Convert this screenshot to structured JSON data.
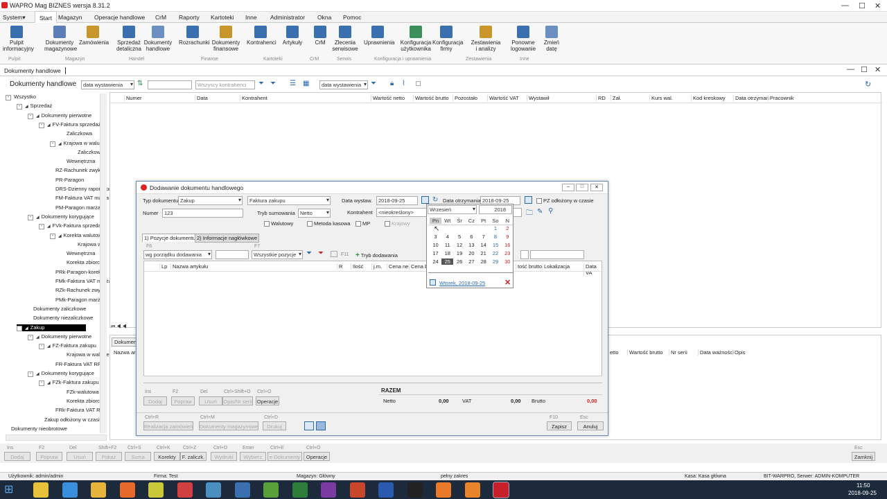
{
  "app": {
    "title": "WAPRO Mag BIZNES  wersja 8.31.2"
  },
  "menu": [
    "System",
    "Start",
    "Magazyn",
    "Operacje handlowe",
    "CrM",
    "Raporty",
    "Kartoteki",
    "Inne",
    "Administrator",
    "Okna",
    "Pomoc"
  ],
  "ribbon": {
    "buttons": [
      {
        "label": "Pulpit informacyjny",
        "color": "#3a6fb0"
      },
      {
        "label": "Dokumenty magazynowe",
        "color": "#5a7fb8"
      },
      {
        "label": "Zamówienia",
        "color": "#c8962b"
      },
      {
        "label": "Sprzedaż detaliczna",
        "color": "#3a6fb0"
      },
      {
        "label": "Dokumenty handlowe",
        "color": "#6a8fc0"
      },
      {
        "label": "Rozrachunki",
        "color": "#3a6fb0"
      },
      {
        "label": "Dokumenty finansowe",
        "color": "#c8962b"
      },
      {
        "label": "Kontrahenci",
        "color": "#3a6fb0"
      },
      {
        "label": "Artykuły",
        "color": "#3a6fb0"
      },
      {
        "label": "CrM",
        "color": "#3a6fb0"
      },
      {
        "label": "Zlecenia serwisowe",
        "color": "#3a6fb0"
      },
      {
        "label": "Uprawnienia",
        "color": "#3a6fb0"
      },
      {
        "label": "Konfiguracja użytkownika",
        "color": "#3a8f5a"
      },
      {
        "label": "Konfiguracja firmy",
        "color": "#3a6fb0"
      },
      {
        "label": "Zestawienia i analizy",
        "color": "#c8962b"
      },
      {
        "label": "Ponowne logowanie",
        "color": "#3a6fb0"
      },
      {
        "label": "Zmień datę",
        "color": "#6a8fc0"
      }
    ],
    "groups": [
      "Pulpit",
      "Magazyn",
      "Handel",
      "Finanse",
      "Kartoteki",
      "CrM",
      "Serwis",
      "Konfiguracja i uprawnienia",
      "Zestawienia",
      "Inne"
    ]
  },
  "doc_tab": "Dokumenty handlowe",
  "toolbar": {
    "title": "Dokumenty handlowe",
    "sort": "data wystawienia",
    "contractor": "Wszyscy kontrahenci",
    "sort2": "data wystawienia"
  },
  "tree": [
    {
      "label": "Wszystko",
      "level": 0,
      "box": "-"
    },
    {
      "label": "Sprzedaż",
      "level": 1,
      "box": "-"
    },
    {
      "label": "Dokumenty pierwotne",
      "level": 2,
      "box": "-"
    },
    {
      "label": "FV-Faktura sprzedaży",
      "level": 3,
      "box": "-"
    },
    {
      "label": "Zaliczkowa",
      "level": 5,
      "box": ""
    },
    {
      "label": "Krajowa w walucie",
      "level": 4,
      "box": "-"
    },
    {
      "label": "Zaliczkowa",
      "level": 6,
      "box": ""
    },
    {
      "label": "Wewnętrzna",
      "level": 5,
      "box": ""
    },
    {
      "label": "RZ-Rachunek zwykły",
      "level": 4,
      "box": ""
    },
    {
      "label": "PR-Paragon",
      "level": 4,
      "box": ""
    },
    {
      "label": "DRS-Dzienny raport sprzedaży",
      "level": 4,
      "box": ""
    },
    {
      "label": "FM-Faktura VAT marża",
      "level": 4,
      "box": ""
    },
    {
      "label": "PM-Paragon marża",
      "level": 4,
      "box": ""
    },
    {
      "label": "Dokumenty korygujące",
      "level": 2,
      "box": "-"
    },
    {
      "label": "FVk-Faktura sprzedaży",
      "level": 3,
      "box": "-"
    },
    {
      "label": "Korekta walutowa",
      "level": 4,
      "box": "-"
    },
    {
      "label": "Krajowa w",
      "level": 6,
      "box": ""
    },
    {
      "label": "Wewnętrzna",
      "level": 5,
      "box": ""
    },
    {
      "label": "Korekta zbiorcza",
      "level": 5,
      "box": ""
    },
    {
      "label": "PRk-Paragon-korekta",
      "level": 4,
      "box": ""
    },
    {
      "label": "FMk-Faktura VAT marża",
      "level": 4,
      "box": ""
    },
    {
      "label": "RZk-Rachunek zwykły",
      "level": 4,
      "box": ""
    },
    {
      "label": "PMk-Paragon marża",
      "level": 4,
      "box": ""
    },
    {
      "label": "Dokumenty zaliczkowe",
      "level": 2,
      "box": ""
    },
    {
      "label": "Dokumenty niezaliczkowe",
      "level": 2,
      "box": ""
    },
    {
      "label": "Zakup",
      "level": 1,
      "box": "-",
      "selected": true
    },
    {
      "label": "Dokumenty pierwotne",
      "level": 2,
      "box": "-"
    },
    {
      "label": "FZ-Faktura zakupu",
      "level": 3,
      "box": "-"
    },
    {
      "label": "Krajowa w walucie",
      "level": 5,
      "box": ""
    },
    {
      "label": "FR-Faktura VAT RR",
      "level": 4,
      "box": ""
    },
    {
      "label": "Dokumenty korygujące",
      "level": 2,
      "box": "-"
    },
    {
      "label": "FZk-Faktura zakupu",
      "level": 3,
      "box": "-"
    },
    {
      "label": "FZk-walutowa k",
      "level": 5,
      "box": ""
    },
    {
      "label": "Korekta zbiorcza",
      "level": 5,
      "box": ""
    },
    {
      "label": "FRk-Faktura VAT RR",
      "level": 4,
      "box": ""
    },
    {
      "label": "Zakup odłożony w czasie",
      "level": 3,
      "box": ""
    },
    {
      "label": "Dokumenty nieobrotowe",
      "level": 0,
      "box": ""
    }
  ],
  "grid": {
    "columns": [
      "Numer",
      "Data",
      "Kontrahent",
      "Wartość netto",
      "Wartość brutto",
      "Pozostało",
      "Wartość VAT",
      "Wystawił",
      "RD",
      "Zał.",
      "Kurs wal.",
      "Kod kreskowy",
      "Data otrzyman",
      "Pracownik"
    ]
  },
  "lower_grid": {
    "tab": "Dokument",
    "col0": "Nazwa ar",
    "columns": [
      "etto",
      "Wartość brutto",
      "Nr serii",
      "Data ważności",
      "Opis"
    ]
  },
  "dialog": {
    "title": "Dodawanie dokumentu handlowego",
    "typ_label": "Typ dokumentu",
    "typ_value": "Zakup",
    "typ2_value": "Faktura zakupu",
    "numer_label": "Numer",
    "numer_value": "123",
    "tryb_label": "Tryb sumowania",
    "tryb_value": "Netto",
    "data_wyst_label": "Data wystaw.",
    "data_wyst_value": "2018-09-25",
    "data_otrz_label": "Data otrzymania",
    "data_otrz_value": "2018-09-25",
    "pz_label": "PZ odłożony w czasie",
    "kontrahent_label": "Kontrahent",
    "kontrahent_value": "<nieokreślony>",
    "checkboxes": [
      "Walutowy",
      "Metoda kasowa",
      "MP",
      "Krajowy"
    ],
    "tabs": [
      "1) Pozycje dokumentu",
      "2) Informacje nagłówkowe"
    ],
    "f6": "F6",
    "f7": "F7",
    "f11": "F11",
    "sort_value": "wg porządku dodawania",
    "filter_value": "Wszystkie pozycje",
    "tryb_dodawania": "Tryb dodawania",
    "columns": [
      "Lp",
      "Nazwa artykułu",
      "R",
      "Ilość",
      "j.m.",
      "Cena ne",
      "Cena b"
    ],
    "columns_right": [
      "tość brutto",
      "Lokalizacja",
      "Data VA"
    ],
    "buttons": [
      {
        "key": "Ins",
        "label": "Dodaj",
        "enabled": false
      },
      {
        "key": "F2",
        "label": "Popraw",
        "enabled": false
      },
      {
        "key": "Del",
        "label": "Usuń",
        "enabled": false
      },
      {
        "key": "Ctrl+Shift+O",
        "label": "Opis/Nr serii",
        "enabled": false
      },
      {
        "key": "Ctrl+O",
        "label": "Operacje",
        "enabled": true
      }
    ],
    "razem": "RAZEM",
    "netto_label": "Netto",
    "netto_value": "0,00",
    "vat_label": "VAT",
    "vat_value": "0,00",
    "brutto_label": "Brutto",
    "brutto_value": "0,00",
    "bottom_buttons": [
      {
        "key": "Ctrl+R",
        "label": "Realizacja zamówień"
      },
      {
        "key": "Ctrl+M",
        "label": "Dokumenty magazynowe"
      },
      {
        "key": "Ctrl+D",
        "label": "Drukuj"
      }
    ],
    "save": {
      "key": "F10",
      "label": "Zapisz"
    },
    "cancel": {
      "key": "Esc",
      "label": "Anuluj"
    }
  },
  "calendar": {
    "month": "Wrzesień",
    "year": "2018",
    "days": [
      "Pn",
      "Wt",
      "Śr",
      "Cz",
      "Pt",
      "So",
      "N"
    ],
    "weeks": [
      [
        "",
        "",
        "",
        "",
        "",
        "1",
        "2"
      ],
      [
        "3",
        "4",
        "5",
        "6",
        "7",
        "8",
        "9"
      ],
      [
        "10",
        "11",
        "12",
        "13",
        "14",
        "15",
        "16"
      ],
      [
        "17",
        "18",
        "19",
        "20",
        "21",
        "22",
        "23"
      ],
      [
        "24",
        "25",
        "26",
        "27",
        "28",
        "29",
        "30"
      ]
    ],
    "selected": "25",
    "today": "Wtorek, 2018-09-25"
  },
  "footer": {
    "buttons": [
      {
        "key": "Ins",
        "label": "Dodaj"
      },
      {
        "key": "F2",
        "label": "Popraw"
      },
      {
        "key": "Del",
        "label": "Usuń"
      },
      {
        "key": "Shift+F2",
        "label": "Pokaż"
      },
      {
        "key": "Ctrl+S",
        "label": "Suma"
      },
      {
        "key": "Ctrl+K",
        "label": "Korekty"
      },
      {
        "key": "Ctrl+Z",
        "label": "F. zaliczk."
      },
      {
        "key": "Ctrl+D",
        "label": "Wydruki"
      },
      {
        "key": "Enter",
        "label": "Wybierz"
      },
      {
        "key": "Ctrl+E",
        "label": "e-Dokumenty"
      },
      {
        "key": "Ctrl+O",
        "label": "Operacje"
      }
    ],
    "close": {
      "key": "Esc",
      "label": "Zamknij"
    }
  },
  "status": {
    "user": "Użytkownik: admin/admin",
    "firm": "Firma: Test",
    "warehouse": "Magazyn: Główny",
    "range": "pełny zakres",
    "cash": "Kasa: Kasa główna",
    "server": "BIT-WARPRO, Serwer: ADMIN-KOMPUTER"
  },
  "taskbar": {
    "time": "11:50",
    "date": "2018-09-25"
  }
}
